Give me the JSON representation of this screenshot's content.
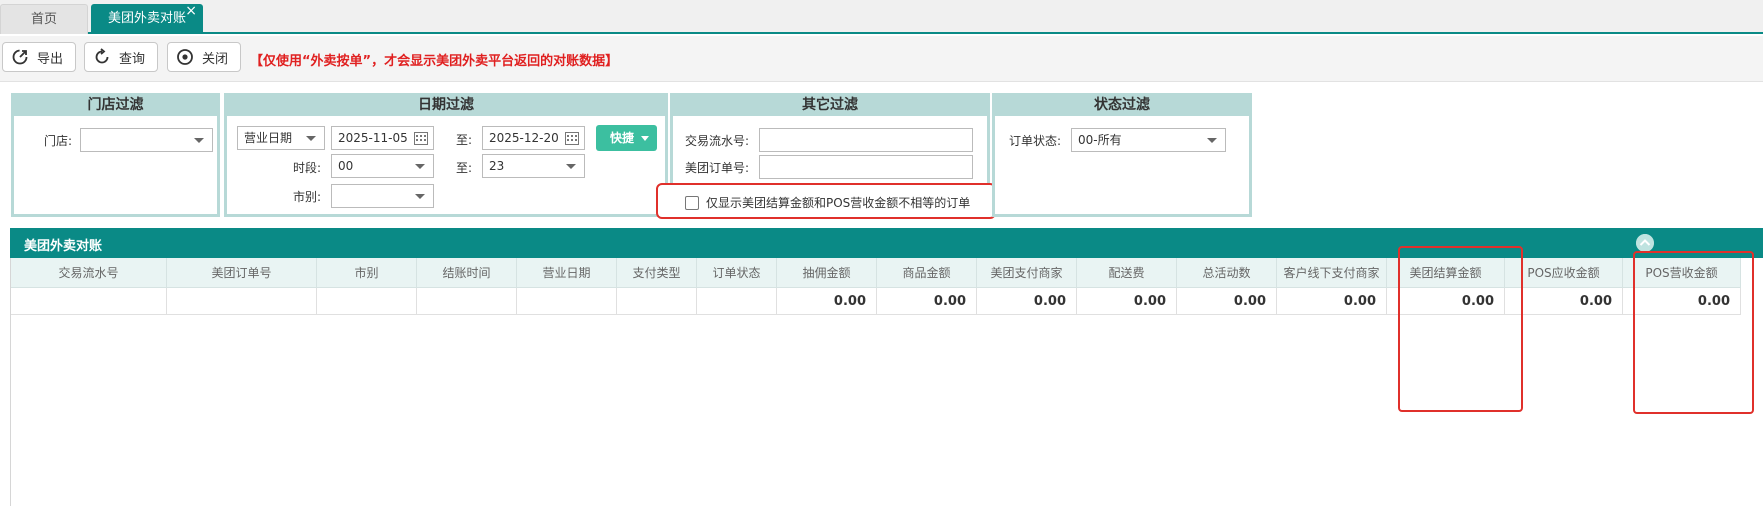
{
  "tabs": {
    "home": "首页",
    "active": "美团外卖对账",
    "close_glyph": "×"
  },
  "toolbar": {
    "export_label": "导出",
    "query_label": "查询",
    "close_label": "关闭",
    "notice": "【仅使用“外卖按单”，才会显示美团外卖平台返回的对账数据】"
  },
  "filters": {
    "store": {
      "title": "门店过滤",
      "store_label": "门店:",
      "store_value": ""
    },
    "date": {
      "title": "日期过滤",
      "date_type": "营业日期",
      "start_date": "2025-11-05",
      "to_label": "至:",
      "end_date": "2025-12-20",
      "quick_label": "快捷",
      "period_label": "时段:",
      "period_start": "00",
      "period_to_label": "至:",
      "period_end": "23",
      "city_label": "市别:",
      "city_value": ""
    },
    "other": {
      "title": "其它过滤",
      "txn_label": "交易流水号:",
      "txn_value": "",
      "order_label": "美团订单号:",
      "order_value": "",
      "mismatch_label": "仅显示美团结算金额和POS营收金额不相等的订单"
    },
    "status": {
      "title": "状态过滤",
      "status_label": "订单状态:",
      "status_value": "00-所有"
    }
  },
  "grid": {
    "title": "美团外卖对账",
    "columns": [
      "交易流水号",
      "美团订单号",
      "市别",
      "结账时间",
      "营业日期",
      "支付类型",
      "订单状态",
      "抽佣金额",
      "商品金额",
      "美团支付商家",
      "配送费",
      "总活动数",
      "客户线下支付商家",
      "美团结算金额",
      "POS应收金额",
      "POS营收金额"
    ],
    "totals": [
      "",
      "",
      "",
      "",
      "",
      "",
      "",
      "0.00",
      "0.00",
      "0.00",
      "0.00",
      "0.00",
      "0.00",
      "0.00",
      "0.00",
      "0.00"
    ]
  },
  "colors": {
    "brand_teal": "#0a8a86",
    "panel_border": "#b7d9d7",
    "notice_red": "#e02020",
    "quick_button": "#3cbfa0",
    "highlight_red": "#e0302b"
  }
}
